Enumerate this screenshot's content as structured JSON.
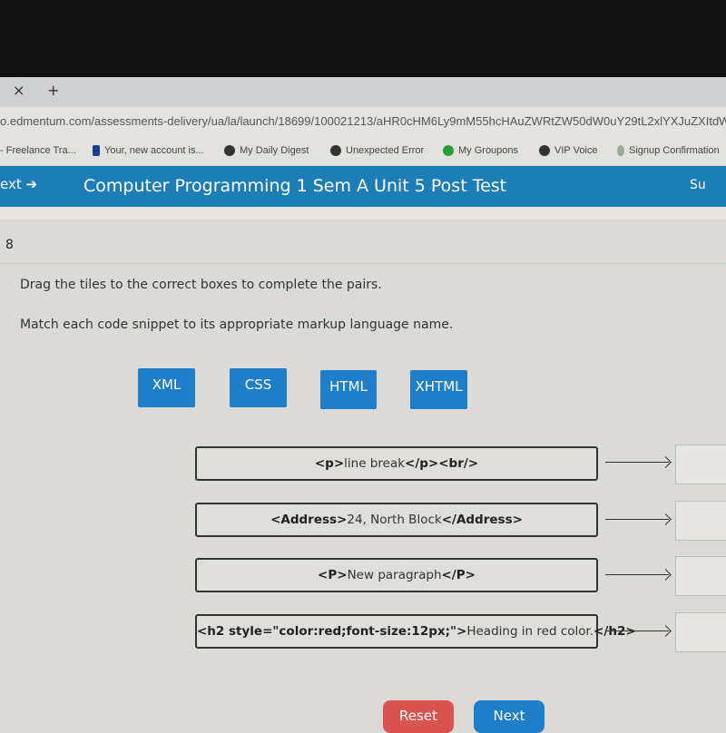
{
  "browser": {
    "close_tab": "×",
    "new_tab": "+",
    "url": "o.edmentum.com/assessments-delivery/ua/la/launch/18699/100021213/aHR0cHM6Ly9mM55hcHAuZWRtZW50dW0uY29tL2xlYXJuZXItdWl",
    "bookmarks": [
      {
        "label": "- Freelance Tra...",
        "icon": "none"
      },
      {
        "label": "Your, new account is...",
        "icon": "paypal-icon"
      },
      {
        "label": "My Daily Digest",
        "icon": "globe-icon"
      },
      {
        "label": "Unexpected Error",
        "icon": "globe-icon"
      },
      {
        "label": "My Groupons",
        "icon": "groupon-icon"
      },
      {
        "label": "VIP Voice",
        "icon": "globe-icon"
      },
      {
        "label": "Signup Confirmation",
        "icon": "leaf-icon"
      }
    ]
  },
  "header": {
    "next": "ext ➔",
    "title": "Computer Programming 1 Sem A Unit 5 Post Test",
    "submit": "Su",
    "color": "#1c7eb5"
  },
  "question": {
    "number": "8",
    "instruction": "Drag the tiles to the correct boxes to complete the pairs.",
    "prompt": "Match each code snippet to its appropriate markup language name.",
    "tiles": [
      "XML",
      "CSS",
      "HTML",
      "XHTML"
    ],
    "pairs": [
      {
        "tag_open": "<p>",
        "text": "line break",
        "tag_close": "</p><br/>"
      },
      {
        "tag_open": "<Address>",
        "text": "24, North Block",
        "tag_close": "</Address>"
      },
      {
        "tag_open": "<P>",
        "text": "New paragraph",
        "tag_close": "</P>"
      },
      {
        "tag_open": "<h2 style=\"color:red;font-size:12px;\">",
        "text": "Heading in red color.",
        "tag_close": "</h2>"
      }
    ]
  },
  "footer": {
    "reset": "Reset",
    "next": "Next",
    "reset_color": "#d9534f",
    "next_color": "#1e7ec8"
  }
}
